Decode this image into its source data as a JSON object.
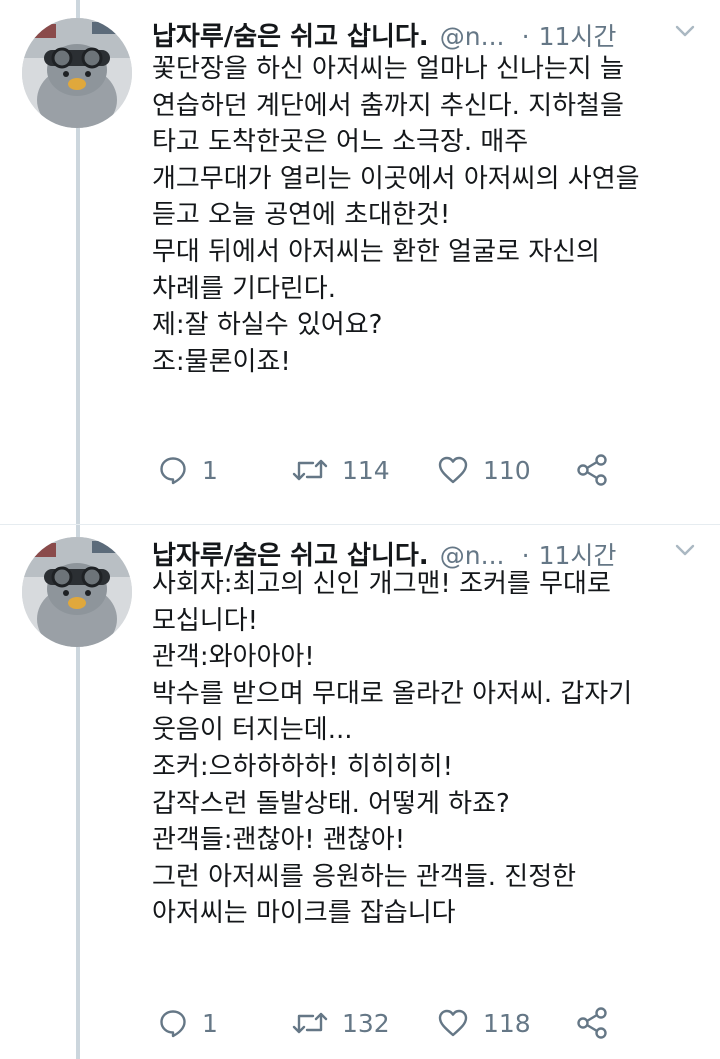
{
  "tweets": [
    {
      "display_name": "납자루/숨은 쉬고 삽니다.",
      "handle": "@n...",
      "separator": "·",
      "time": "11시간",
      "lines": [
        "꽃단장을 하신 아저씨는 얼마나 신나는지 늘",
        "연습하던 계단에서 춤까지 추신다. 지하철을",
        "타고 도착한곳은 어느 소극장. 매주",
        "개그무대가 열리는 이곳에서 아저씨의 사연을",
        "듣고 오늘 공연에 초대한것!",
        "무대 뒤에서 아저씨는 환한 얼굴로 자신의",
        "차례를 기다린다.",
        "제:잘 하실수 있어요?",
        "조:물론이죠!"
      ],
      "replies": "1",
      "retweets": "114",
      "likes": "110"
    },
    {
      "display_name": "납자루/숨은 쉬고 삽니다.",
      "handle": "@n...",
      "separator": "·",
      "time": "11시간",
      "lines": [
        "사회자:최고의 신인 개그맨! 조커를 무대로",
        "모십니다!",
        "관객:와아아아!",
        "박수를 받으며 무대로 올라간 아저씨. 갑자기",
        "웃음이 터지는데...",
        "조커:으하하하하! 히히히히!",
        "갑작스런 돌발상태. 어떻게 하죠?",
        "관객들:괜찮아! 괜찮아!",
        "그런 아저씨를 응원하는 관객들. 진정한",
        "아저씨는 마이크를 잡습니다"
      ],
      "replies": "1",
      "retweets": "132",
      "likes": "118"
    }
  ],
  "icons": {
    "reply": "reply-icon",
    "retweet": "retweet-icon",
    "like": "heart-icon",
    "share": "share-icon",
    "caret": "chevron-down-icon"
  },
  "colors": {
    "text": "#14171a",
    "secondary": "#657786",
    "thread_line": "#ccd6dd"
  }
}
